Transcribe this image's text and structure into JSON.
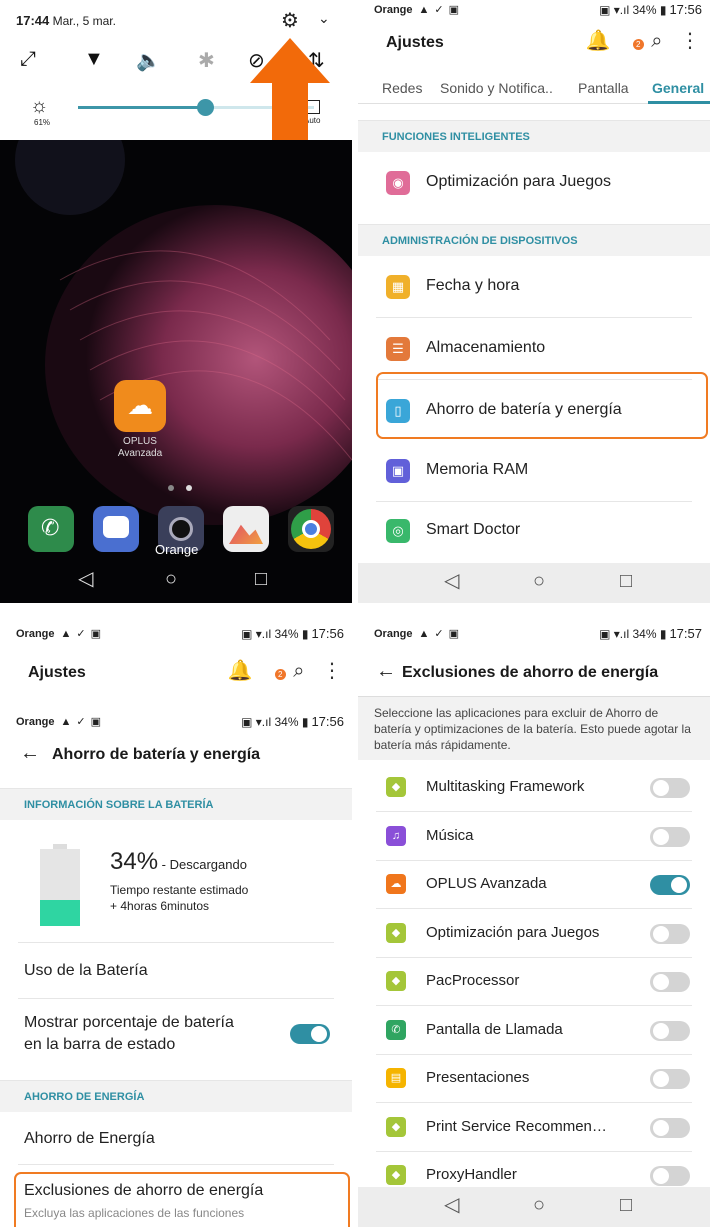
{
  "colors": {
    "accent": "#2f8fa3",
    "highlight": "#f07b22",
    "arrow": "#f26a0a",
    "battery_level": "#2fd5a2"
  },
  "quick_settings": {
    "time": "17:44",
    "date": "Mar., 5 mar.",
    "brightness_percent": "61%",
    "brightness_level": 0.54,
    "auto_label": "Auto"
  },
  "home_screen": {
    "app_label_line1": "OPLUS",
    "app_label_line2": "Avanzada",
    "dock_label": "Orange"
  },
  "status_bar": {
    "carrier": "Orange",
    "battery": "34%",
    "time_a": "17:56",
    "time_b": "17:57"
  },
  "settings": {
    "title": "Ajustes",
    "badge": "2",
    "tabs": [
      "Redes",
      "Sonido y Notifica..",
      "Pantalla",
      "General"
    ],
    "section_smart": "FUNCIONES INTELIGENTES",
    "section_devices": "ADMINISTRACIÓN DE DISPOSITIVOS",
    "items": [
      {
        "label": "Optimización para Juegos",
        "icon": "gamepad-icon",
        "color": "#e06c98"
      },
      {
        "label": "Fecha y hora",
        "icon": "calendar-icon",
        "color": "#f0b02a"
      },
      {
        "label": "Almacenamiento",
        "icon": "storage-icon",
        "color": "#e3793b"
      },
      {
        "label": "Ahorro de batería y energía",
        "icon": "battery-icon",
        "color": "#3aa6d8"
      },
      {
        "label": "Memoria RAM",
        "icon": "chip-icon",
        "color": "#6160d9"
      },
      {
        "label": "Smart Doctor",
        "icon": "doctor-icon",
        "color": "#39b86b"
      }
    ]
  },
  "battery_screen": {
    "title": "Ahorro de batería y energía",
    "section_info": "INFORMACIÓN SOBRE LA BATERÍA",
    "percent": "34%",
    "percent_suffix": " - Descargando",
    "level": 0.34,
    "estimate_line1": "Tiempo restante estimado",
    "estimate_line2": "+ 4horas 6minutos",
    "usage": "Uso de la Batería",
    "show_percent_line1": "Mostrar porcentaje de batería",
    "show_percent_line2": "en la barra de estado",
    "show_percent_on": true,
    "section_saving": "AHORRO DE ENERGÍA",
    "saving": "Ahorro de Energía",
    "exclusions": "Exclusiones de ahorro de energía",
    "exclusions_sub": "Excluya las aplicaciones de las funciones"
  },
  "exclusions_screen": {
    "title": "Exclusiones de ahorro de energía",
    "description": "Seleccione las aplicaciones para excluir de Ahorro de batería y optimizaciones de la batería. Esto puede agotar la batería más rápidamente.",
    "apps": [
      {
        "label": "Multitasking Framework",
        "icon": "android-icon",
        "color": "#a4c639",
        "on": false
      },
      {
        "label": "Música",
        "icon": "music-icon",
        "color": "#8a4fd8",
        "on": false
      },
      {
        "label": "OPLUS Avanzada",
        "icon": "oplus-icon",
        "color": "#f0761c",
        "on": true
      },
      {
        "label": "Optimización para Juegos",
        "icon": "android-icon",
        "color": "#a4c639",
        "on": false
      },
      {
        "label": "PacProcessor",
        "icon": "android-icon",
        "color": "#a4c639",
        "on": false
      },
      {
        "label": "Pantalla de Llamada",
        "icon": "phone-icon",
        "color": "#2fa561",
        "on": false
      },
      {
        "label": "Presentaciones",
        "icon": "slides-icon",
        "color": "#f5b400",
        "on": false
      },
      {
        "label": "Print Service Recommen…",
        "icon": "android-icon",
        "color": "#a4c639",
        "on": false
      },
      {
        "label": "ProxyHandler",
        "icon": "android-icon",
        "color": "#a4c639",
        "on": false
      }
    ]
  }
}
